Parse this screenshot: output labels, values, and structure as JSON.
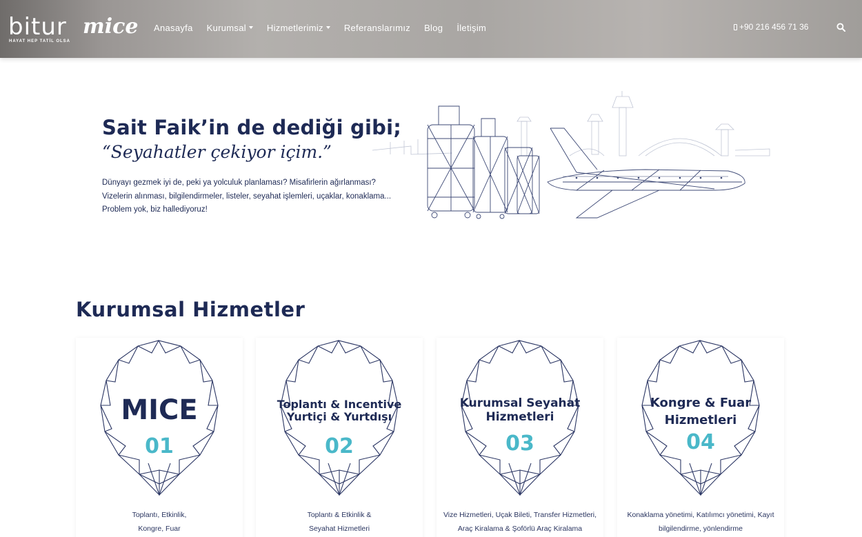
{
  "header": {
    "logo_text": "bitur",
    "logo_script": "mice",
    "logo_tagline": "HAYAT HEP TATİL OLSA",
    "nav": [
      {
        "label": "Anasayfa",
        "dropdown": false
      },
      {
        "label": "Kurumsal",
        "dropdown": true
      },
      {
        "label": "Hizmetlerimiz",
        "dropdown": true
      },
      {
        "label": "Referanslarımız",
        "dropdown": false
      },
      {
        "label": "Blog",
        "dropdown": false
      },
      {
        "label": "İletişim",
        "dropdown": false
      }
    ],
    "phone": "+90 216 456 71 36",
    "icons": {
      "phone": "mobile-phone-icon",
      "search": "search-icon"
    }
  },
  "hero": {
    "title": "Sait Faik’in de dediği gibi;",
    "quote": "“Seyahatler çekiyor içim.”",
    "lines": [
      "Dünyayı gezmek iyi de, peki ya yolculuk planlaması? Misafirlerin ağırlanması?",
      "Vizelerin alınması, bilgilendirmeler, listeler, seyahat işlemleri, uçaklar, konaklama...",
      "Problem yok, biz hallediyoruz!"
    ]
  },
  "section": {
    "title": "Kurumsal Hizmetler",
    "cards": [
      {
        "title_lines": [
          "MICE"
        ],
        "number": "01",
        "desc_lines": [
          "Toplantı, Etkinlik,",
          "Kongre, Fuar"
        ]
      },
      {
        "title_lines": [
          "Toplantı & Incentive",
          "Yurtiçi & Yurtdışı"
        ],
        "number": "02",
        "desc_lines": [
          "Toplantı & Etkinlik &",
          "Seyahat Hizmetleri"
        ]
      },
      {
        "title_lines": [
          "Kurumsal Seyahat",
          "Hizmetleri"
        ],
        "number": "03",
        "desc_lines": [
          "Vize Hizmetleri, Uçak Bileti, Transfer Hizmetleri,",
          "Araç Kiralama & Şoförlü Araç Kiralama"
        ]
      },
      {
        "title_lines": [
          "Kongre & Fuar",
          "Hizmetleri"
        ],
        "number": "04",
        "desc_lines": [
          "Konaklama yönetimi, Katılımcı yönetimi, Kayıt",
          "bilgilendirme, yönlendirme"
        ]
      }
    ]
  },
  "colors": {
    "navy": "#1e2a55",
    "accent": "#4ab8c9",
    "header_bg": "#a9a6a3"
  }
}
